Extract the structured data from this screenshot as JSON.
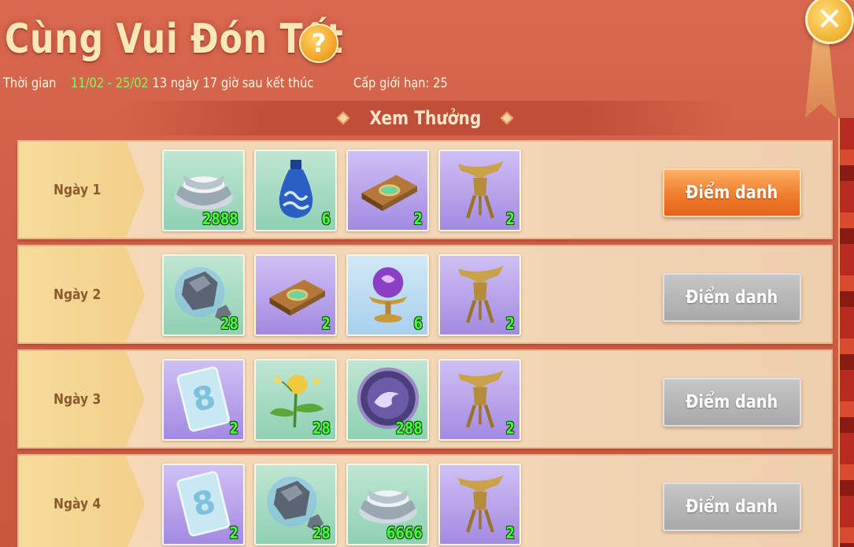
{
  "header": {
    "title": "Cùng Vui Đón Tết",
    "help_label": "?",
    "close_label": "✕",
    "time_label": "Thời gian",
    "date_range": "11/02 - 25/02",
    "countdown": "13 ngày 17 giờ sau kết thúc",
    "level_limit": "Cấp giới hạn: 25"
  },
  "section": {
    "title": "Xem Thưởng"
  },
  "days": [
    {
      "label": "Ngày 1",
      "button": "Điểm danh",
      "button_state": "active",
      "items": [
        {
          "icon": "silver-ingot-icon",
          "bg": "green",
          "count": "2888"
        },
        {
          "icon": "blue-vase-icon",
          "bg": "green",
          "count": "6"
        },
        {
          "icon": "jade-book-icon",
          "bg": "purple",
          "count": "2"
        },
        {
          "icon": "bronze-goblet-icon",
          "bg": "purple",
          "count": "2"
        }
      ]
    },
    {
      "label": "Ngày 2",
      "button": "Điểm danh",
      "button_state": "disabled",
      "items": [
        {
          "icon": "ore-stone-icon",
          "bg": "green",
          "count": "28"
        },
        {
          "icon": "jade-book-icon",
          "bg": "purple",
          "count": "2"
        },
        {
          "icon": "crystal-orb-icon",
          "bg": "blue",
          "count": "6"
        },
        {
          "icon": "bronze-goblet-icon",
          "bg": "purple",
          "count": "2"
        }
      ]
    },
    {
      "label": "Ngày 3",
      "button": "Điểm danh",
      "button_state": "disabled",
      "items": [
        {
          "icon": "ticket-card-icon",
          "bg": "purple",
          "count": "2"
        },
        {
          "icon": "golden-flower-icon",
          "bg": "green",
          "count": "28"
        },
        {
          "icon": "spirit-coin-icon",
          "bg": "green",
          "count": "288"
        },
        {
          "icon": "bronze-goblet-icon",
          "bg": "purple",
          "count": "2"
        }
      ]
    },
    {
      "label": "Ngày 4",
      "button": "Điểm danh",
      "button_state": "disabled",
      "items": [
        {
          "icon": "ticket-card-icon",
          "bg": "purple",
          "count": "2"
        },
        {
          "icon": "ore-stone-icon",
          "bg": "green",
          "count": "28"
        },
        {
          "icon": "silver-ingot-icon",
          "bg": "green",
          "count": "6666"
        },
        {
          "icon": "bronze-goblet-icon",
          "bg": "purple",
          "count": "2"
        }
      ]
    }
  ]
}
